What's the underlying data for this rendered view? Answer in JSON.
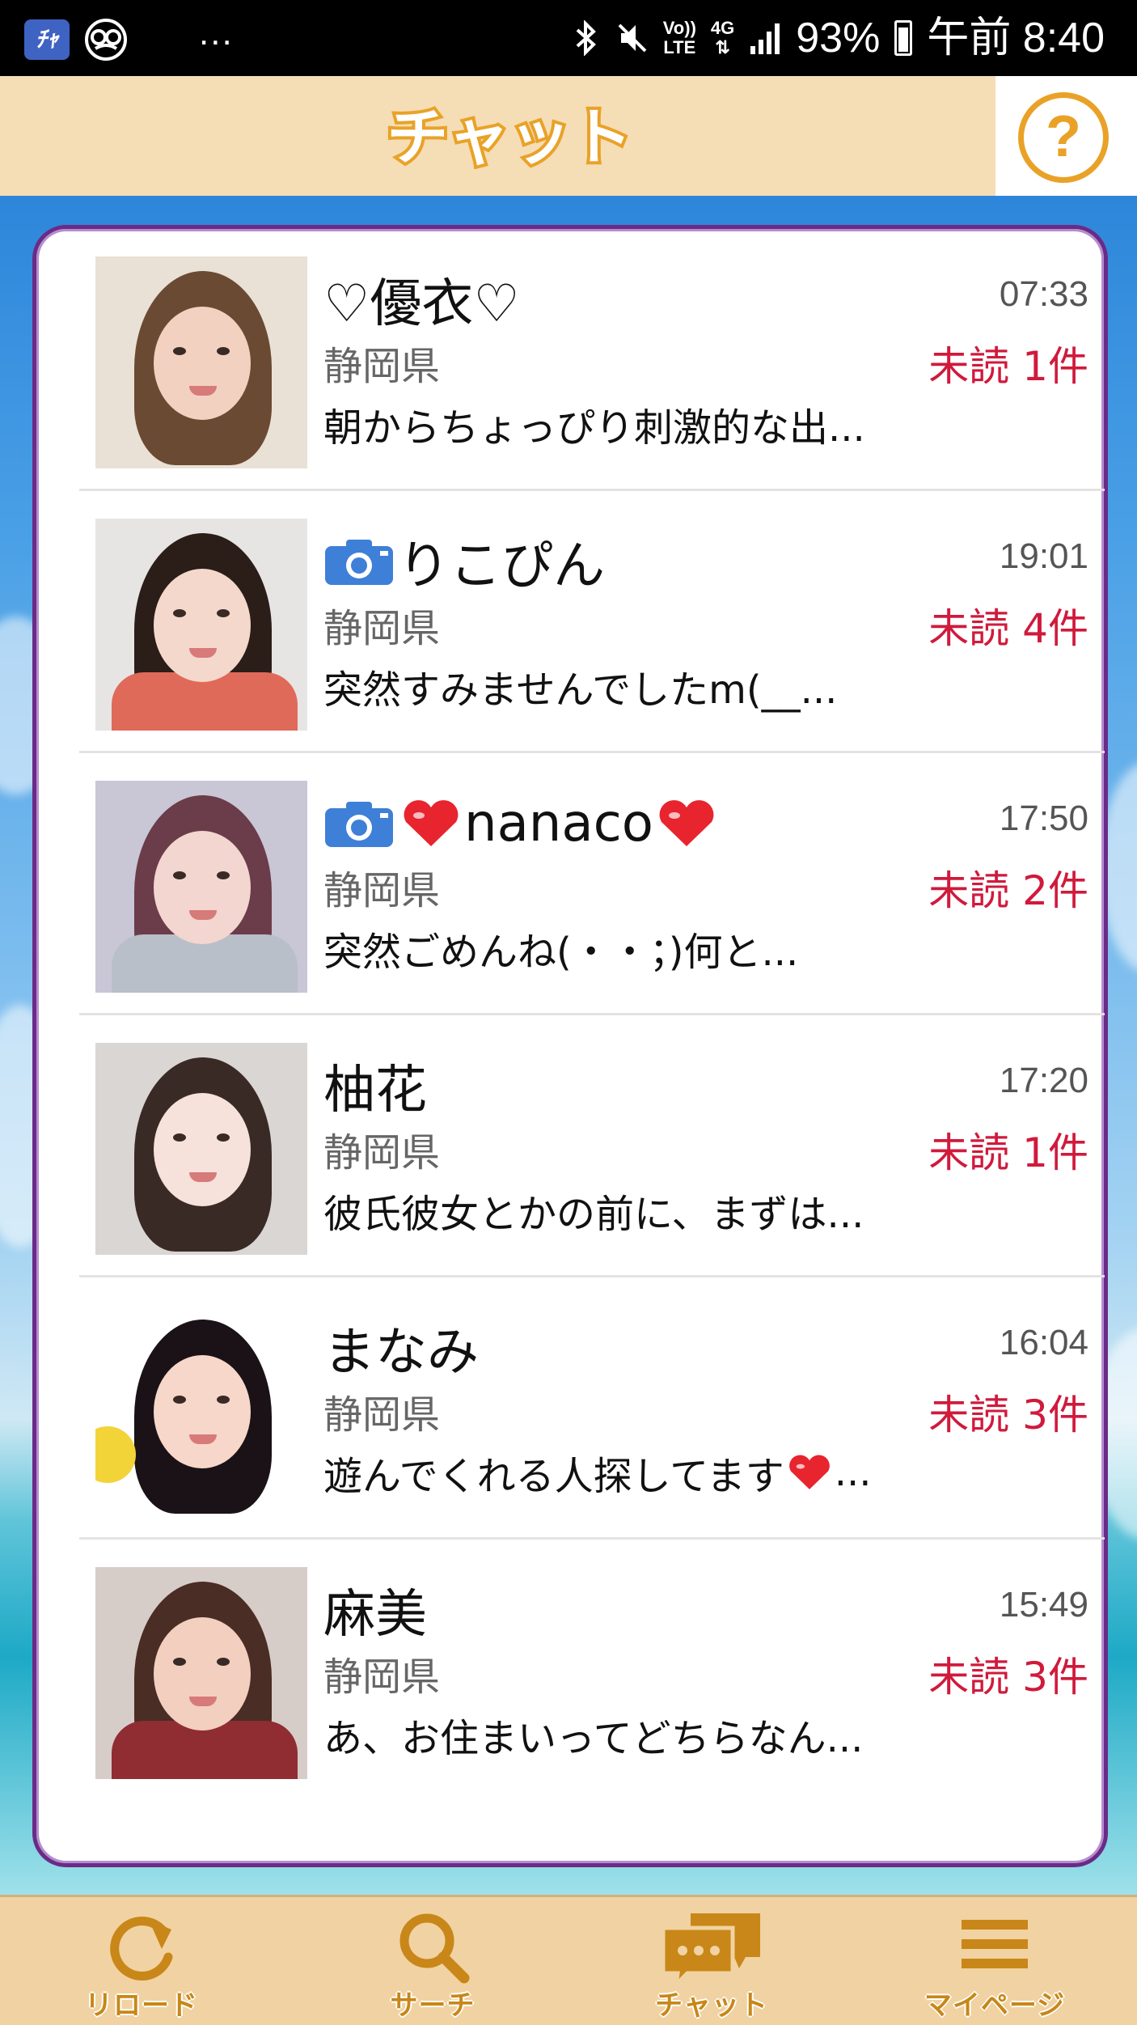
{
  "status_bar": {
    "app_icon_1": "ﾁｬ",
    "more": "...",
    "volte_top": "Vo))",
    "volte_bottom": "LTE",
    "network": "4G",
    "battery": "93%",
    "time": "午前 8:40"
  },
  "header": {
    "title": "チャット",
    "help_label": "?"
  },
  "colors": {
    "header_bg": "#f5ddb6",
    "accent_orange": "#e9a227",
    "unread_red": "#d01a3c",
    "card_border": "#6a2b86",
    "nav_bg": "#f1d2a2"
  },
  "chats": [
    {
      "name": "♡優衣♡",
      "time": "07:33",
      "prefecture": "静岡県",
      "unread": "未読 1件",
      "preview": "朝からちょっぴり刺激的な出...",
      "has_camera": false
    },
    {
      "name": "りこぴん",
      "time": "19:01",
      "prefecture": "静岡県",
      "unread": "未読 4件",
      "preview": "突然すみませんでしたm(__...",
      "has_camera": true
    },
    {
      "name": "nanaco",
      "time": "17:50",
      "prefecture": "静岡県",
      "unread": "未読 2件",
      "preview": "突然ごめんね(・・；)何と...",
      "has_camera": true
    },
    {
      "name": "柚花",
      "time": "17:20",
      "prefecture": "静岡県",
      "unread": "未読 1件",
      "preview": "彼氏彼女とかの前に、まずは...",
      "has_camera": false
    },
    {
      "name": "まなみ",
      "time": "16:04",
      "prefecture": "静岡県",
      "unread": "未読 3件",
      "preview": "遊んでくれる人探してます",
      "preview_suffix": "...",
      "has_camera": false
    },
    {
      "name": "麻美",
      "time": "15:49",
      "prefecture": "静岡県",
      "unread": "未読 3件",
      "preview": "あ、お住まいってどちらなん...",
      "has_camera": false
    }
  ],
  "bottom_nav": [
    {
      "label": "リロード",
      "icon": "reload-icon"
    },
    {
      "label": "サーチ",
      "icon": "search-icon"
    },
    {
      "label": "チャット",
      "icon": "chat-icon"
    },
    {
      "label": "マイページ",
      "icon": "menu-icon"
    }
  ]
}
